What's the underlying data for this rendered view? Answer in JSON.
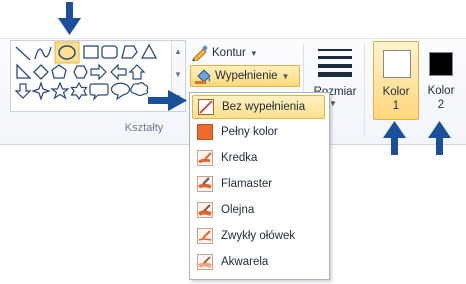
{
  "ribbon": {
    "group_shapes_label": "Kształty",
    "outline_label": "Kontur",
    "fill_label": "Wypełnienie",
    "size_label": "Rozmiar",
    "color1_label": "Kolor",
    "color1_num": "1",
    "color2_label": "Kolor",
    "color2_num": "2",
    "colors": {
      "color1": "#ffffff",
      "color2": "#000000",
      "accent_arrow": "#1a4f9c",
      "highlight": "#ffd978"
    }
  },
  "fill_menu": {
    "items": [
      {
        "label": "Bez wypełnienia",
        "icon": "no-fill-icon"
      },
      {
        "label": "Pełny kolor",
        "icon": "solid-color-icon"
      },
      {
        "label": "Kredka",
        "icon": "crayon-icon"
      },
      {
        "label": "Flamaster",
        "icon": "marker-icon"
      },
      {
        "label": "Olejna",
        "icon": "oil-paint-icon"
      },
      {
        "label": "Zwykły ołówek",
        "icon": "pencil-icon"
      },
      {
        "label": "Akwarela",
        "icon": "watercolor-icon"
      }
    ],
    "selected_index": 0
  }
}
